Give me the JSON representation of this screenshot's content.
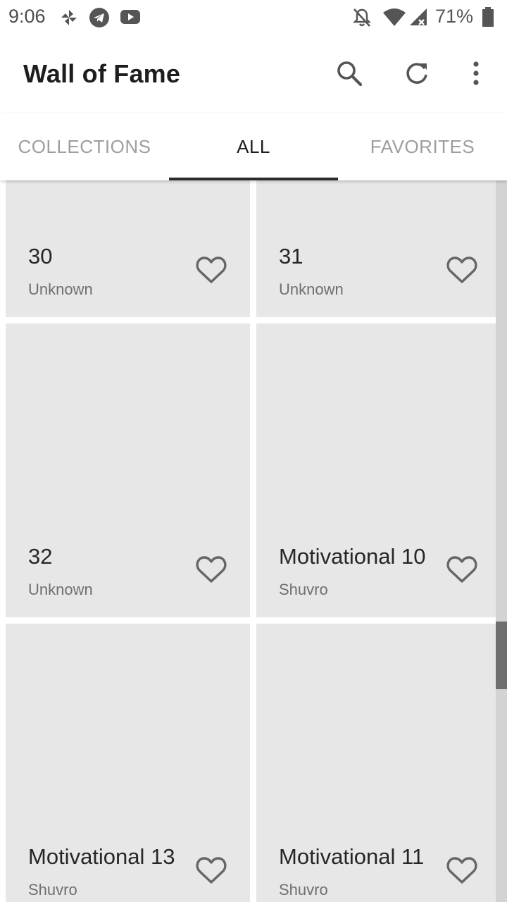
{
  "status_bar": {
    "time": "9:06",
    "battery_percent": "71%",
    "icons": [
      "pinwheel-icon",
      "telegram-icon",
      "youtube-icon",
      "notifications-off-icon",
      "wifi-icon",
      "signal-icon",
      "battery-icon"
    ]
  },
  "app_bar": {
    "title": "Wall of Fame",
    "actions": [
      "search-icon",
      "refresh-icon",
      "more-vert-icon"
    ]
  },
  "tabs": [
    {
      "label": "COLLECTIONS",
      "active": false
    },
    {
      "label": "ALL",
      "active": true
    },
    {
      "label": "FAVORITES",
      "active": false
    }
  ],
  "cards": [
    {
      "title": "30",
      "author": "Unknown",
      "favorite": false
    },
    {
      "title": "31",
      "author": "Unknown",
      "favorite": false
    },
    {
      "title": "32",
      "author": "Unknown",
      "favorite": false
    },
    {
      "title": "Motivational 10",
      "author": "Shuvro",
      "favorite": false
    },
    {
      "title": "Motivational 13",
      "author": "Shuvro",
      "favorite": false
    },
    {
      "title": "Motivational 11",
      "author": "Shuvro",
      "favorite": false
    }
  ],
  "colors": {
    "card_background": "#e7e7e7",
    "tab_indicator": "#2b2b2b",
    "inactive_tab": "#9e9e9e",
    "scroll_thumb": "#6e6e6e"
  }
}
